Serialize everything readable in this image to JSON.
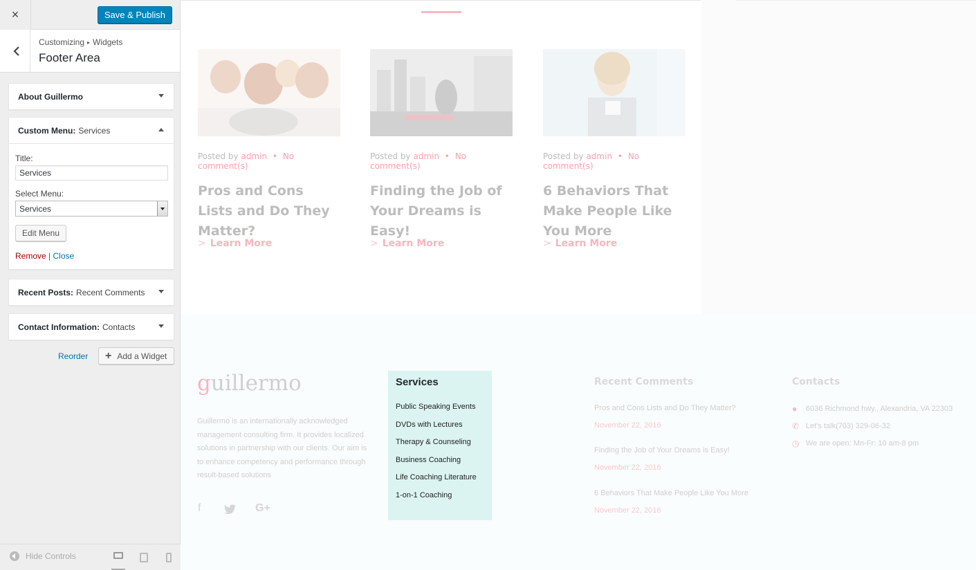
{
  "customizer": {
    "close_icon": "×",
    "save_label": "Save & Publish",
    "breadcrumb": {
      "part1": "Customizing",
      "separator": "▸",
      "part2": "Widgets"
    },
    "section_title": "Footer Area",
    "widgets": [
      {
        "label": "About Guillermo",
        "sub": ""
      },
      {
        "label": "Custom Menu:",
        "sub": "Services"
      },
      {
        "label": "Recent Posts:",
        "sub": "Recent Comments"
      },
      {
        "label": "Contact Information:",
        "sub": "Contacts"
      }
    ],
    "form": {
      "title_label": "Title:",
      "title_value": "Services",
      "select_label": "Select Menu:",
      "select_value": "Services",
      "edit_menu_label": "Edit Menu",
      "remove_label": "Remove",
      "divider": "|",
      "close_label": "Close"
    },
    "reorder_label": "Reorder",
    "add_widget_label": "Add a Widget",
    "hide_controls_label": "Hide Controls"
  },
  "preview": {
    "posts": [
      {
        "posted_by": "Posted by",
        "author": "admin",
        "dot": "•",
        "comments": "No comment(s)",
        "title": "Pros and Cons Lists and Do They Matter?",
        "learn_more": "Learn More"
      },
      {
        "posted_by": "Posted by",
        "author": "admin",
        "dot": "•",
        "comments": "No comment(s)",
        "title": "Finding the Job of Your Dreams is Easy!",
        "learn_more": "Learn More"
      },
      {
        "posted_by": "Posted by",
        "author": "admin",
        "dot": "•",
        "comments": "No comment(s)",
        "title": "6 Behaviors That Make People Like You More",
        "learn_more": "Learn More"
      }
    ],
    "footer": {
      "logo_first": "g",
      "logo_rest": "uillermo",
      "about": "Guillermo is an internationally acknowledged management consulting firm. It provides localized solutions in partnership with our clients. Our aim is to enhance competency and performance through result-based solutions",
      "services_title": "Services",
      "services": [
        "Public Speaking Events",
        "DVDs with Lectures",
        "Therapy & Counseling",
        "Business Coaching",
        "Life Coaching Literature",
        "1-on-1 Coaching"
      ],
      "recent_comments_title": "Recent Comments",
      "recent_comments": [
        {
          "title": "Pros and Cons Lists and Do They Matter?",
          "date": "November 22, 2016"
        },
        {
          "title": "Finding the Job of Your Dreams is Easy!",
          "date": "November 22, 2016"
        },
        {
          "title": "6 Behaviors That Make People Like You More",
          "date": "November 22, 2016"
        }
      ],
      "contacts_title": "Contacts",
      "contacts": [
        {
          "icon": "map-pin-icon",
          "text": "6036 Richmond hwy., Alexandria, VA 22303"
        },
        {
          "icon": "phone-icon",
          "text": "Let's talk(703) 329-06-32"
        },
        {
          "icon": "clock-icon",
          "text": "We are open: Mn-Fr: 10 am-8 pm"
        }
      ]
    }
  }
}
